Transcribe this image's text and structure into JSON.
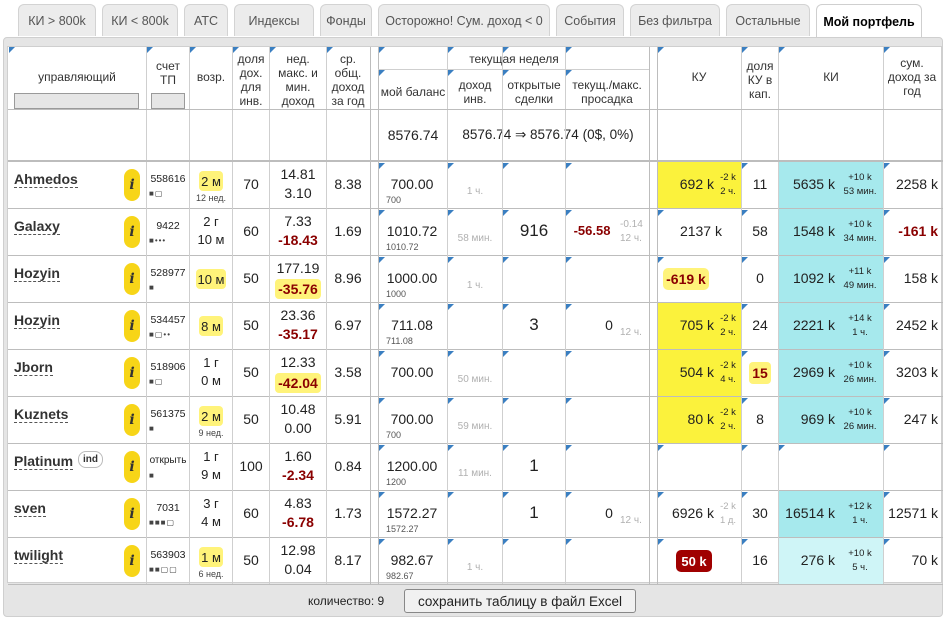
{
  "tabs": [
    {
      "label": "КИ > 800k",
      "active": false
    },
    {
      "label": "КИ < 800k",
      "active": false
    },
    {
      "label": "АТС",
      "active": false
    },
    {
      "label": "Индексы",
      "active": false
    },
    {
      "label": "Фонды",
      "active": false
    },
    {
      "label": "Осторожно! Сум. доход < 0",
      "active": false
    },
    {
      "label": "События",
      "active": false
    },
    {
      "label": "Без фильтра",
      "active": false
    },
    {
      "label": "Остальные",
      "active": false
    },
    {
      "label": "Мой портфель",
      "active": true
    }
  ],
  "headers": {
    "manager": "управляющий",
    "account": "счет ТП",
    "age": "возр.",
    "share_income": "доля дох. для инв.",
    "weekly_maxmin": "нед. макс. и мин. доход",
    "avg_income": "ср. общ. доход за год",
    "current_week": "текущая неделя",
    "my_balance": "мой баланс",
    "investor_income": "доход инв.",
    "open_deals": "открытые сделки",
    "drawdown": "текущ./макс. просадка",
    "ku": "КУ",
    "ku_share": "доля КУ в кап.",
    "ki": "КИ",
    "sum_income": "сум. доход за год"
  },
  "summary": {
    "balance": "8576.74",
    "formula": "8576.74 ⇒ 8576.74 (0$, 0%)"
  },
  "rows": [
    {
      "name": "Ahmedos",
      "badge": "",
      "account": "558616",
      "dots": "■▢",
      "age1": "2 м",
      "age2": "12 нед.",
      "age_hl": true,
      "share": "70",
      "max": "14.81",
      "min": "3.10",
      "min_red": false,
      "min_hl": false,
      "avg": "8.38",
      "bal": "700.00",
      "bal_sub": "700",
      "inv_time": "1 ч.",
      "open": "",
      "dd_cur": "",
      "dd_max": "",
      "dd_time": "",
      "ku": "692 k",
      "ku_note1": "-2 k",
      "ku_note2": "2 ч.",
      "ku_style": "yellow",
      "ku_share": "11",
      "ku_share_hl": false,
      "ki": "5635 k",
      "ki_note1": "+10 k",
      "ki_note2": "53 мин.",
      "ki_style": "cyan",
      "sum": "2258 k",
      "sum_red": false
    },
    {
      "name": "Galaxy",
      "badge": "",
      "account": "9422",
      "dots": "■•••",
      "age1": "2 г",
      "age2": "10 м",
      "age_hl": false,
      "share": "60",
      "max": "7.33",
      "min": "-18.43",
      "min_red": true,
      "min_hl": false,
      "avg": "1.69",
      "bal": "1010.72",
      "bal_sub": "1010.72",
      "inv_time": "58 мин.",
      "open": "916",
      "dd_cur": "-56.58",
      "dd_max": "-0.14",
      "dd_time": "12 ч.",
      "ku": "2137 k",
      "ku_note1": "",
      "ku_note2": "",
      "ku_style": "plain",
      "ku_share": "58",
      "ku_share_hl": false,
      "ki": "1548 k",
      "ki_note1": "+10 k",
      "ki_note2": "34 мин.",
      "ki_style": "cyan",
      "sum": "-161 k",
      "sum_red": true
    },
    {
      "name": "Hozyin",
      "badge": "",
      "account": "528977",
      "dots": "■",
      "age1": "10 м",
      "age2": "",
      "age_hl": true,
      "share": "50",
      "max": "177.19",
      "min": "-35.76",
      "min_red": true,
      "min_hl": true,
      "avg": "8.96",
      "bal": "1000.00",
      "bal_sub": "1000",
      "inv_time": "1 ч.",
      "open": "",
      "dd_cur": "",
      "dd_max": "",
      "dd_time": "",
      "ku": "-619 k",
      "ku_note1": "",
      "ku_note2": "",
      "ku_style": "neg",
      "ku_share": "0",
      "ku_share_hl": false,
      "ki": "1092 k",
      "ki_note1": "+11 k",
      "ki_note2": "49 мин.",
      "ki_style": "cyan",
      "sum": "158 k",
      "sum_red": false
    },
    {
      "name": "Hozyin",
      "badge": "",
      "account": "534457",
      "dots": "■▢••",
      "age1": "8 м",
      "age2": "",
      "age_hl": true,
      "share": "50",
      "max": "23.36",
      "min": "-35.17",
      "min_red": true,
      "min_hl": false,
      "avg": "6.97",
      "bal": "711.08",
      "bal_sub": "711.08",
      "inv_time": "",
      "open": "3",
      "dd_cur": "0",
      "dd_max": "",
      "dd_time": "12 ч.",
      "ku": "705 k",
      "ku_note1": "-2 k",
      "ku_note2": "2 ч.",
      "ku_style": "yellow",
      "ku_share": "24",
      "ku_share_hl": false,
      "ki": "2221 k",
      "ki_note1": "+14 k",
      "ki_note2": "1 ч.",
      "ki_style": "cyan",
      "sum": "2452 k",
      "sum_red": false
    },
    {
      "name": "Jborn",
      "badge": "",
      "account": "518906",
      "dots": "■▢",
      "age1": "1 г",
      "age2": "0 м",
      "age_hl": false,
      "share": "50",
      "max": "12.33",
      "min": "-42.04",
      "min_red": true,
      "min_hl": true,
      "avg": "3.58",
      "bal": "700.00",
      "bal_sub": "",
      "inv_time": "50 мин.",
      "open": "",
      "dd_cur": "",
      "dd_max": "",
      "dd_time": "",
      "ku": "504 k",
      "ku_note1": "-2 k",
      "ku_note2": "4 ч.",
      "ku_style": "yellow",
      "ku_share": "15",
      "ku_share_hl": true,
      "ki": "2969 k",
      "ki_note1": "+10 k",
      "ki_note2": "26 мин.",
      "ki_style": "cyan",
      "sum": "3203 k",
      "sum_red": false
    },
    {
      "name": "Kuznets",
      "badge": "",
      "account": "561375",
      "dots": "■",
      "age1": "2 м",
      "age2": "9 нед.",
      "age_hl": true,
      "share": "50",
      "max": "10.48",
      "min": "0.00",
      "min_red": false,
      "min_hl": false,
      "avg": "5.91",
      "bal": "700.00",
      "bal_sub": "700",
      "inv_time": "59 мин.",
      "open": "",
      "dd_cur": "",
      "dd_max": "",
      "dd_time": "",
      "ku": "80 k",
      "ku_note1": "-2 k",
      "ku_note2": "2 ч.",
      "ku_style": "yellow",
      "ku_share": "8",
      "ku_share_hl": false,
      "ki": "969 k",
      "ki_note1": "+10 k",
      "ki_note2": "26 мин.",
      "ki_style": "cyan",
      "sum": "247 k",
      "sum_red": false
    },
    {
      "name": "Platinum",
      "badge": "ind",
      "account": "открыть",
      "dots": "■",
      "age1": "1 г",
      "age2": "9 м",
      "age_hl": false,
      "share": "100",
      "max": "1.60",
      "min": "-2.34",
      "min_red": true,
      "min_hl": false,
      "avg": "0.84",
      "bal": "1200.00",
      "bal_sub": "1200",
      "inv_time": "11 мин.",
      "open": "1",
      "dd_cur": "",
      "dd_max": "",
      "dd_time": "",
      "ku": "",
      "ku_note1": "",
      "ku_note2": "",
      "ku_style": "plain",
      "ku_share": "",
      "ku_share_hl": false,
      "ki": "",
      "ki_note1": "",
      "ki_note2": "",
      "ki_style": "none",
      "sum": "",
      "sum_red": false
    },
    {
      "name": "sven",
      "badge": "",
      "account": "7031",
      "dots": "■■■▢",
      "age1": "3 г",
      "age2": "4 м",
      "age_hl": false,
      "share": "60",
      "max": "4.83",
      "min": "-6.78",
      "min_red": true,
      "min_hl": false,
      "avg": "1.73",
      "bal": "1572.27",
      "bal_sub": "1572.27",
      "inv_time": "",
      "open": "1",
      "dd_cur": "0",
      "dd_max": "",
      "dd_time": "12 ч.",
      "ku": "6926 k",
      "ku_note1": "-2 k",
      "ku_note2": "1 д.",
      "ku_style": "plain-note",
      "ku_share": "30",
      "ku_share_hl": false,
      "ki": "16514 k",
      "ki_note1": "+12 k",
      "ki_note2": "1 ч.",
      "ki_style": "cyan",
      "sum": "12571 k",
      "sum_red": false
    },
    {
      "name": "twilight",
      "badge": "",
      "account": "563903",
      "dots": "■■▢▢",
      "age1": "1 м",
      "age2": "6 нед.",
      "age_hl": true,
      "share": "50",
      "max": "12.98",
      "min": "0.04",
      "min_red": false,
      "min_hl": false,
      "avg": "8.17",
      "bal": "982.67",
      "bal_sub": "982.67",
      "inv_time": "1 ч.",
      "open": "",
      "dd_cur": "",
      "dd_max": "",
      "dd_time": "",
      "ku": "50 k",
      "ku_note1": "",
      "ku_note2": "",
      "ku_style": "darkred",
      "ku_share": "16",
      "ku_share_hl": false,
      "ki": "276 k",
      "ki_note1": "+10 k",
      "ki_note2": "5 ч.",
      "ki_style": "lightcyan",
      "sum": "70 k",
      "sum_red": false
    }
  ],
  "footer": {
    "count_label": "количество: 9",
    "excel_button": "сохранить таблицу в файл Excel"
  },
  "colors": {
    "yellow": "#fbf23c",
    "cyan": "#a6e9ed",
    "light_cyan": "#cff5f7",
    "negative_red": "#8a0000",
    "accent_blue": "#3a7fc1",
    "info_badge": "#f7d518"
  }
}
